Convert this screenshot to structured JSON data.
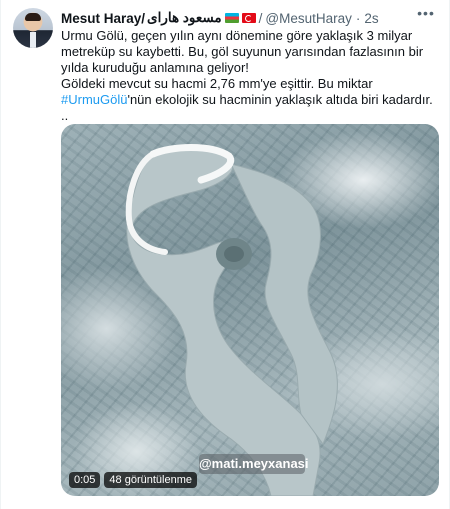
{
  "tweet": {
    "author_name": "Mesut Haray/",
    "author_name_arabic": "مسعود هارای",
    "flags": [
      "flag-azerbaijan-icon",
      "flag-turkey-icon"
    ],
    "separator": "/",
    "handle": "@MesutHaray",
    "dot": "·",
    "time": "2s",
    "more_icon": "more-options-icon",
    "text": {
      "line1": "Urmu Gölü, geçen yılın aynı dönemine göre yaklaşık 3 milyar metreküp su kaybetti.  Bu, göl suyunun yarısından fazlasının bir yılda kuruduğu anlamına geliyor!",
      "line2_before": "Göldeki mevcut su hacmi 2,76 mm'ye eşittir. Bu miktar ",
      "hashtag": "#UrmuGölü",
      "line2_after": "'nün ekolojik su hacminin yaklaşık altıda biri kadardır.",
      "line3": ".."
    },
    "media": {
      "watermark": "@mati.meyxanasi",
      "duration": "0:05",
      "views": "48 görüntülenme"
    }
  }
}
